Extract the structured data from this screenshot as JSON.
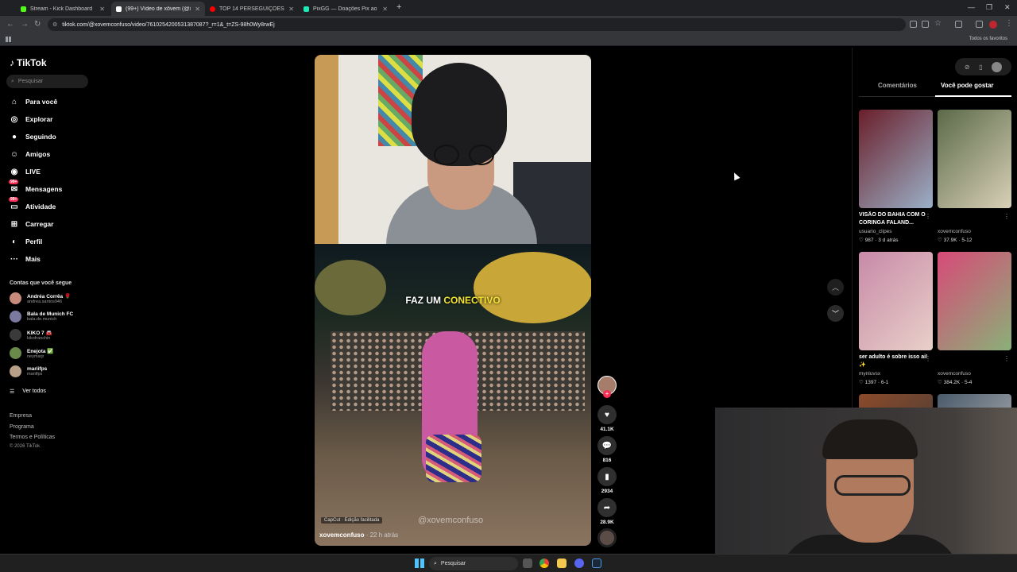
{
  "browser": {
    "tabs": [
      {
        "title": "Stream - Kick Dashboard",
        "fav_color": "#53fc18",
        "active": false
      },
      {
        "title": "(99+) Vídeo de xõvem (@xo",
        "fav_color": "#ffffff",
        "active": true
      },
      {
        "title": "TOP 14 PERSEGUIÇÕES DE I",
        "fav_color": "#ff0000",
        "active": false
      },
      {
        "title": "PixGG — Doações Pix ao vivo p",
        "fav_color": "#1de9b6",
        "active": false
      }
    ],
    "url": "tiktok.com/@xovemconfuso/video/7610254200531387087?_r=1&_t=ZS-98h0Wy8rwEj",
    "bookmarks_all": "Todos os favoritos"
  },
  "tiktok": {
    "logo": "TikTok",
    "search_placeholder": "Pesquisar",
    "nav": [
      {
        "label": "Para você",
        "icon": "home-icon",
        "glyph": "⌂",
        "badge": ""
      },
      {
        "label": "Explorar",
        "icon": "compass-icon",
        "glyph": "◎",
        "badge": ""
      },
      {
        "label": "Seguindo",
        "icon": "following-icon",
        "glyph": "●",
        "badge": ""
      },
      {
        "label": "Amigos",
        "icon": "friends-icon",
        "glyph": "☺",
        "badge": ""
      },
      {
        "label": "LIVE",
        "icon": "live-icon",
        "glyph": "◉",
        "badge": ""
      },
      {
        "label": "Mensagens",
        "icon": "messages-icon",
        "glyph": "✉",
        "badge": "99+"
      },
      {
        "label": "Atividade",
        "icon": "activity-icon",
        "glyph": "▭",
        "badge": "99+"
      },
      {
        "label": "Carregar",
        "icon": "upload-icon",
        "glyph": "⊞",
        "badge": ""
      },
      {
        "label": "Perfil",
        "icon": "profile-icon",
        "glyph": "◐",
        "badge": ""
      },
      {
        "label": "Mais",
        "icon": "more-icon",
        "glyph": "···",
        "badge": ""
      }
    ],
    "following_header": "Contas que você segue",
    "following": [
      {
        "name": "Andréa Corrêa 🌹",
        "handle": "andrea.santos946"
      },
      {
        "name": "Bala de Munich FC",
        "handle": "bala.de.munich"
      },
      {
        "name": "KIKO 7 🚘",
        "handle": "kikofranchin"
      },
      {
        "name": "Enejota ✅",
        "handle": "neymarjr"
      },
      {
        "name": "mariifps",
        "handle": "mariifps"
      }
    ],
    "see_all": "Ver todos",
    "footer": [
      "Empresa",
      "Programa",
      "Termos e Políticas"
    ],
    "copyright": "© 2026 TikTok"
  },
  "video": {
    "caption_plain": "FAZ UM ",
    "caption_highlight": "CONECTIVO",
    "watermark": "@xovemconfuso",
    "capcut": "CapCut · Edição facilitada",
    "author": "xovemconfuso",
    "time": " · 22 h atrás",
    "likes": "41.1K",
    "comments": "816",
    "saves": "2934",
    "shares": "28.9K"
  },
  "right_panel": {
    "tabs": [
      "Comentários",
      "Você pode gostar"
    ],
    "cards": [
      {
        "title": "VISÃO DO BAHIA COM O CORINGA FALAND...",
        "user": "usuario_clipes",
        "meta": "♡ 987 · 3 d atrás",
        "colors": [
          "#6a1f2a",
          "#9ab0c8"
        ]
      },
      {
        "title": "",
        "user": "xovemconfuso",
        "meta": "♡ 37.9K · 5-12",
        "colors": [
          "#5b6a48",
          "#d8d0b8"
        ]
      },
      {
        "title": "ser adulto é sobre isso ai! ✨",
        "user": "mynluvsx",
        "meta": "♡ 1397 · 6-1",
        "colors": [
          "#c88aa8",
          "#e8d0c8"
        ]
      },
      {
        "title": "",
        "user": "xovemconfuso",
        "meta": "♡ 384.2K · 5-4",
        "colors": [
          "#d84a78",
          "#8ab078"
        ]
      },
      {
        "title": "",
        "user": "",
        "meta": "",
        "colors": [
          "#8a4a2a",
          "#3a3a3a"
        ]
      },
      {
        "title": "",
        "user": "",
        "meta": "",
        "colors": [
          "#4a5a6a",
          "#c8c8c8"
        ]
      }
    ]
  },
  "taskbar": {
    "search": "Pesquisar"
  }
}
